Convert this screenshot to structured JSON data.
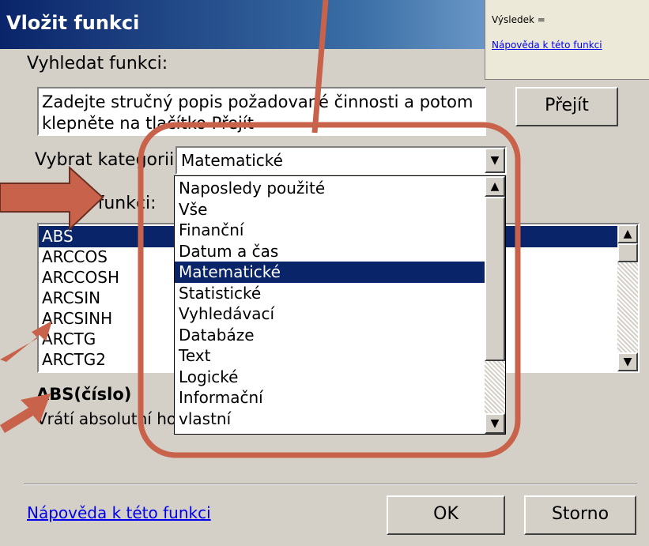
{
  "dialog": {
    "title": "Vložit funkci",
    "search_label": "Vyhledat funkci:",
    "search_value": "Zadejte stručný popis požadované činnosti a potom klepněte na tlačítko Přejít",
    "go_button": "Přejít",
    "category_label": "Vybrat kategorii:",
    "category_value": "Matematické",
    "function_label": "Vybrat funkci:",
    "functions": [
      "ABS",
      "ARCCOS",
      "ARCCOSH",
      "ARCSIN",
      "ARCSINH",
      "ARCTG",
      "ARCTG2"
    ],
    "selected_function": "ABS",
    "signature": "ABS(číslo)",
    "description": "Vrátí absolutní hodnotu čísla.",
    "help_link": "Nápověda k této funkci",
    "ok_button": "OK",
    "cancel_button": "Storno"
  },
  "category_dropdown": {
    "options": [
      "Naposledy použité",
      "Vše",
      "Finanční",
      "Datum a čas",
      "Matematické",
      "Statistické",
      "Vyhledávací",
      "Databáze",
      "Text",
      "Logické",
      "Informační",
      "vlastní"
    ],
    "selected": "Matematické"
  },
  "background_window": {
    "result_label": "Výsledek =",
    "help_link": "Nápověda k této funkci"
  },
  "annotation": {
    "color": "#c8624a"
  },
  "colors": {
    "title_start": "#0a246a",
    "title_end": "#a6caf0",
    "selection": "#0a246a",
    "link": "#0000ee"
  }
}
